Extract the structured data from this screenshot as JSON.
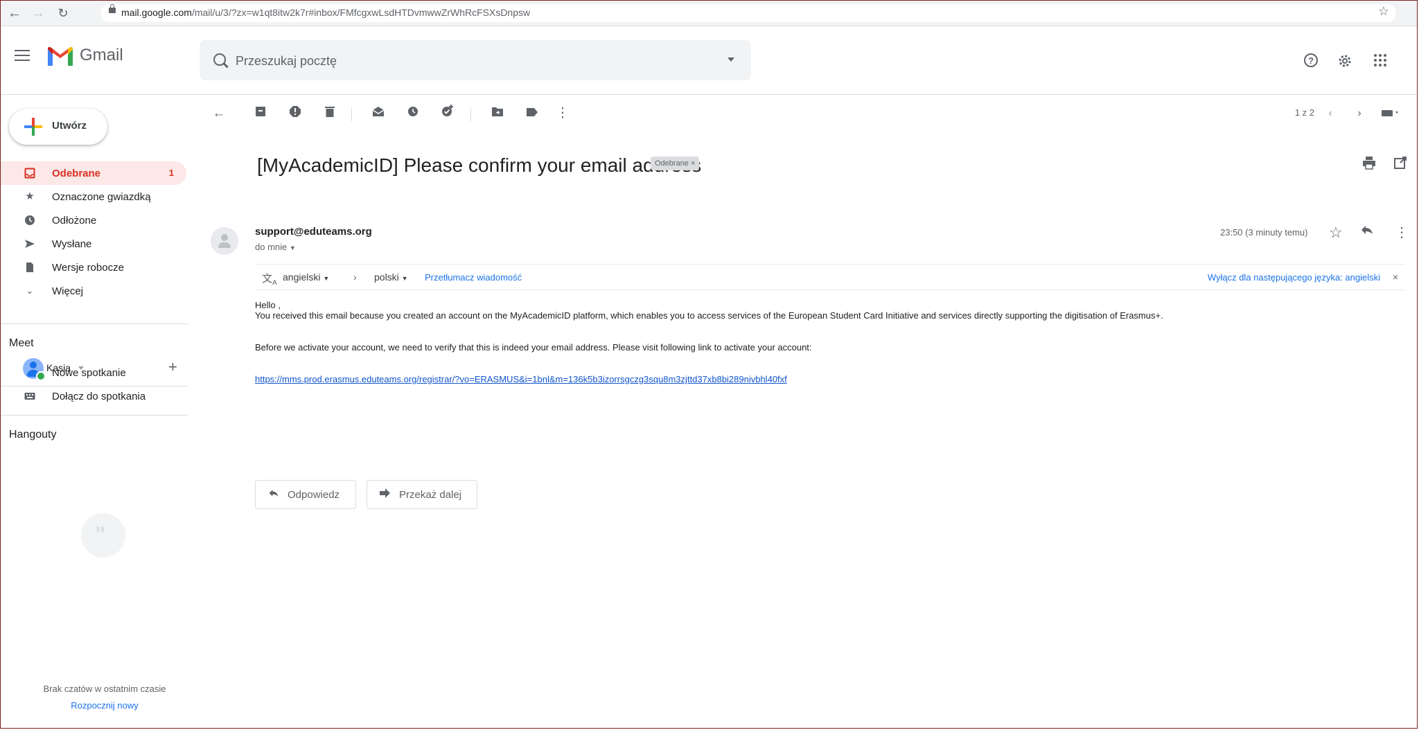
{
  "browser": {
    "url_host": "mail.google.com",
    "url_path": "/mail/u/3/?zx=w1qt8itw2k7r#inbox/FMfcgxwLsdHTDvmwwZrWhRcFSXsDnpsw"
  },
  "header": {
    "app_name": "Gmail",
    "search_placeholder": "Przeszukaj pocztę"
  },
  "sidebar": {
    "compose_label": "Utwórz",
    "items": [
      {
        "label": "Odebrane",
        "count": "1",
        "icon": "inbox-icon"
      },
      {
        "label": "Oznaczone gwiazdką",
        "icon": "star-icon"
      },
      {
        "label": "Odłożone",
        "icon": "clock-icon"
      },
      {
        "label": "Wysłane",
        "icon": "send-icon"
      },
      {
        "label": "Wersje robocze",
        "icon": "draft-icon"
      },
      {
        "label": "Więcej",
        "icon": "chevron-down-icon"
      }
    ],
    "meet_heading": "Meet",
    "meet_items": [
      {
        "label": "Nowe spotkanie",
        "icon": "video-icon"
      },
      {
        "label": "Dołącz do spotkania",
        "icon": "keyboard-icon"
      }
    ],
    "hangouts_heading": "Hangouty",
    "hangouts_user": "Kasia",
    "no_chats": "Brak czatów w ostatnim czasie",
    "start_new": "Rozpocznij nowy"
  },
  "toolbar": {
    "pager": "1 z 2"
  },
  "email": {
    "subject": "[MyAcademicID] Please confirm your email address",
    "label_chip": "Odebrane ×",
    "sender": "support@eduteams.org",
    "to": "do mnie",
    "time": "23:50 (3 minuty temu)",
    "translate": {
      "from_lang": "angielski",
      "to_lang": "polski",
      "translate_link": "Przetłumacz wiadomość",
      "disable_link": "Wyłącz dla następującego języka: angielski"
    },
    "greeting": "Hello ,",
    "paragraph1": "You received this email because you created an account on the MyAcademicID platform, which enables you to access services of the European Student Card Initiative and services directly supporting the digitisation of Erasmus+.",
    "paragraph2": "Before we activate your account, we need to verify that this is indeed your email address. Please visit following link to activate your account:",
    "link": "https://mms.prod.erasmus.eduteams.org/registrar/?vo=ERASMUS&i=1bnl&m=136k5b3izorrsgczg3squ8m3zjttd37xb8bi289nivbhl40fxf",
    "reply_label": "Odpowiedz",
    "forward_label": "Przekaż dalej"
  },
  "colors": {
    "accent_red": "#d93025",
    "active_bg": "#fce8e6",
    "link_blue": "#1a73e8"
  }
}
